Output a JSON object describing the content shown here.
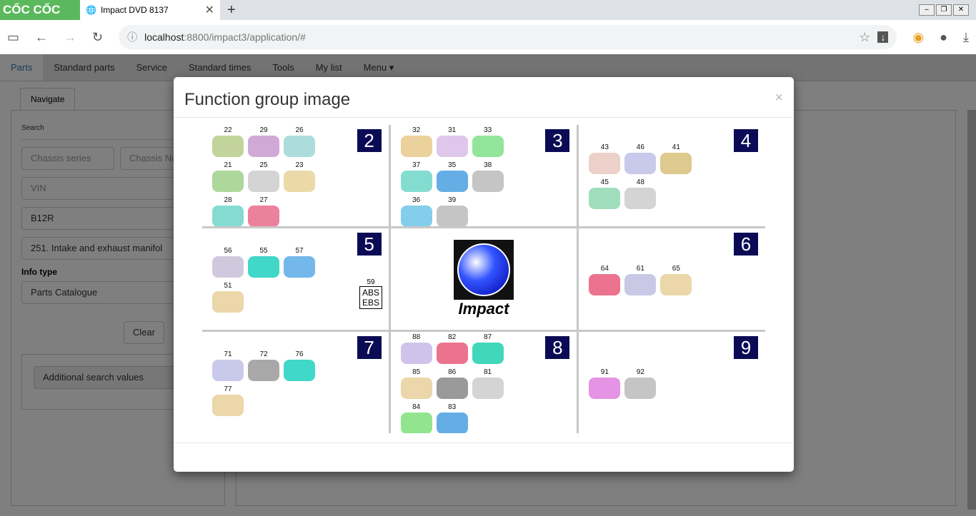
{
  "browser": {
    "brand": "CỐC CỐC",
    "tab_title": "Impact DVD 8137",
    "url_host": "localhost",
    "url_rest": ":8800/impact3/application/#"
  },
  "nav": {
    "items": [
      "Parts",
      "Standard parts",
      "Service",
      "Standard times",
      "Tools",
      "My list",
      "Menu ▾"
    ]
  },
  "subtab": "Navigate",
  "search": {
    "heading": "Search",
    "chassis_series": "Chassis series",
    "chassis_no": "Chassis No",
    "vin": "VIN",
    "model": "B12R",
    "function_group": "251. Intake and exhaust manifol",
    "info_type_label": "Info type",
    "info_type": "Parts Catalogue",
    "clear": "Clear",
    "additional": "Additional search values"
  },
  "modal": {
    "title": "Function group image",
    "close": "×",
    "cells": [
      {
        "group": "2",
        "parts": [
          "22",
          "29",
          "26",
          "21",
          "25",
          "23",
          "28",
          "27"
        ],
        "colors": [
          "#b7cc8a",
          "#c89ad0",
          "#9ed6d6",
          "#9fd08a",
          "#ccc",
          "#e8d29a",
          "#6fd6c9",
          "#e86b8a"
        ]
      },
      {
        "group": "3",
        "parts": [
          "32",
          "31",
          "33",
          "37",
          "35",
          "38",
          "36",
          "39"
        ],
        "colors": [
          "#e8c98a",
          "#d8bde8",
          "#7fe08a",
          "#6fd6c9",
          "#4aa0e0",
          "#bbb",
          "#6fc6e8",
          "#bbb"
        ]
      },
      {
        "group": "4",
        "parts": [
          "43",
          "46",
          "41",
          "45",
          "48"
        ],
        "colors": [
          "#e8c9c0",
          "#c0c0e8",
          "#d8c07a",
          "#8fd8b0",
          "#ccc"
        ]
      },
      {
        "group": "5",
        "parts": [
          "56",
          "55",
          "57",
          "51"
        ],
        "colors": [
          "#c8c0d8",
          "#20d0c0",
          "#5aaae8",
          "#e8d09a"
        ],
        "extra_label": "59",
        "extra_lines": [
          "ABS",
          "EBS"
        ]
      },
      {
        "logo": "Impact"
      },
      {
        "group": "6",
        "parts": [
          "64",
          "61",
          "65"
        ],
        "colors": [
          "#e85a7a",
          "#c0c0e0",
          "#e8d09a"
        ]
      },
      {
        "group": "7",
        "parts": [
          "71",
          "72",
          "76",
          "77"
        ],
        "colors": [
          "#c0c0e8",
          "#999",
          "#20d0c0",
          "#e8d09a"
        ]
      },
      {
        "group": "8",
        "parts": [
          "88",
          "82",
          "87",
          "85",
          "86",
          "81",
          "84",
          "83"
        ],
        "colors": [
          "#c8b8e8",
          "#e85a7a",
          "#20d0b0",
          "#e8d09a",
          "#888",
          "#ccc",
          "#7fe07a",
          "#4aa0e0"
        ]
      },
      {
        "group": "9",
        "parts": [
          "91",
          "92"
        ],
        "colors": [
          "#e080e0",
          "#bbb"
        ]
      }
    ]
  }
}
